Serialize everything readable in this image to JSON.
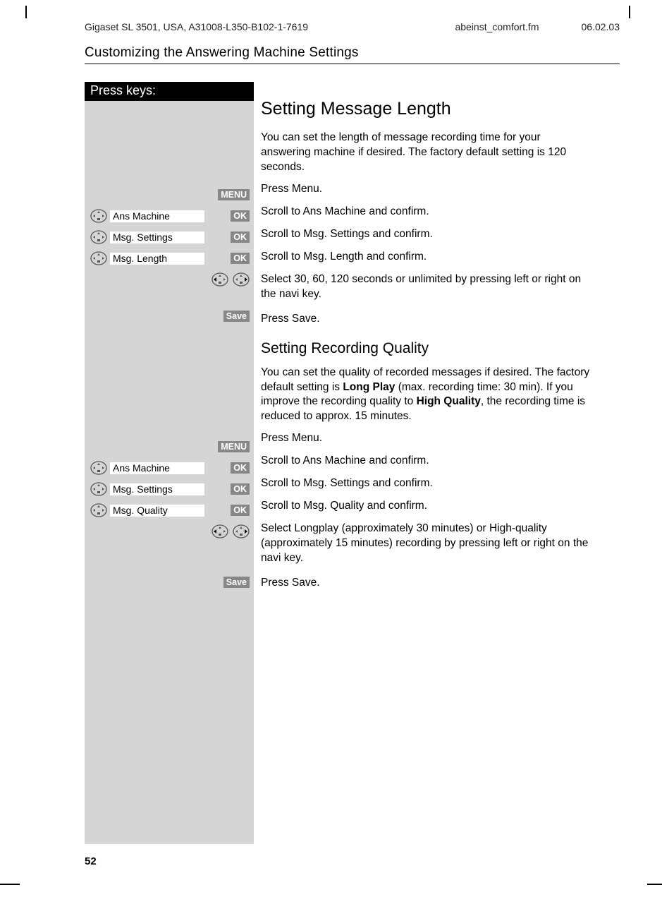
{
  "header": {
    "product": "Gigaset SL 3501, USA, A31008-L350-B102-1-7619",
    "file": "abeinst_comfort.fm",
    "date": "06.02.03"
  },
  "section_title": "Customizing the Answering Machine Settings",
  "press_keys_label": "Press keys:",
  "badges": {
    "menu": "MENU",
    "ok": "OK",
    "save": "Save"
  },
  "menu_items": {
    "ans_machine": "Ans Machine",
    "msg_settings": "Msg. Settings",
    "msg_length": "Msg. Length",
    "msg_quality": "Msg. Quality"
  },
  "s1": {
    "title": "Setting Message Length",
    "intro": "You can set the length of message recording time for your answering machine if desired.  The factory default setting is 120 seconds.",
    "steps": {
      "press_menu": "Press Menu.",
      "ans_machine": "Scroll to Ans Machine and confirm.",
      "msg_settings": "Scroll to Msg. Settings and confirm.",
      "msg_length": "Scroll to Msg. Length and confirm.",
      "select": "Select 30, 60, 120 seconds or unlimited by pressing left or right on the navi key.",
      "press_save": "Press Save."
    }
  },
  "s2": {
    "title": "Setting Recording Quality",
    "intro_pre": "You can set the quality of recorded messages if desired.  The factory default setting is ",
    "intro_b1": "Long Play",
    "intro_mid": " (max. recording time: 30 min).  If you improve the recording quality to ",
    "intro_b2": "High Quality",
    "intro_post": ", the recording time is reduced to approx. 15 minutes.",
    "steps": {
      "press_menu": "Press Menu.",
      "ans_machine": "Scroll to Ans Machine and confirm.",
      "msg_settings": "Scroll to Msg. Settings and confirm.",
      "msg_quality": "Scroll to Msg. Quality and confirm.",
      "select": "Select Longplay (approximately 30 minutes) or High-quality (approximately 15 minutes) recording by pressing left or right on the navi key.",
      "press_save": "Press Save."
    }
  },
  "page_number": "52"
}
